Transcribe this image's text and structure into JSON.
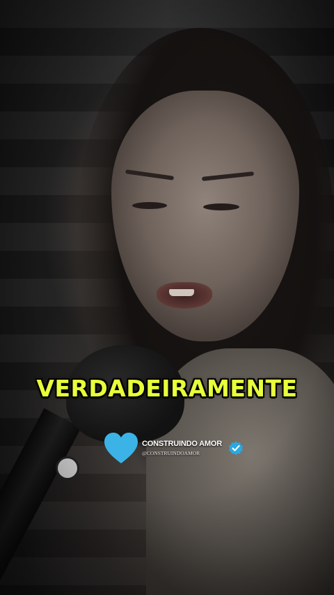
{
  "caption": {
    "text": "VERDADEIRAMENTE",
    "color": "#e8ff3a"
  },
  "brand": {
    "name": "CONSTRUINDO AMOR",
    "handle": "@CONSTRUINDOAMOR",
    "heart_icon": "heart-icon",
    "heart_color": "#3bb3e6",
    "verified_icon": "verified-badge-icon",
    "verified_color": "#29a9e0"
  }
}
